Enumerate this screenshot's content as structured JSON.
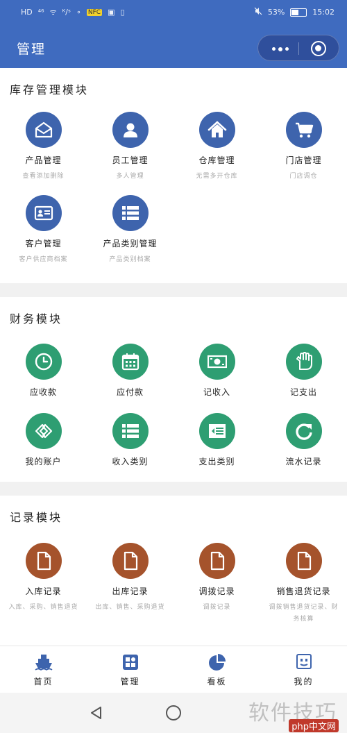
{
  "statusbar": {
    "left_items": [
      "HD",
      "⁴⁶",
      "ᯤ",
      "ᴷ/ˢ",
      "∘",
      "NFC",
      "▣",
      "▯"
    ],
    "battery_pct": "53%",
    "battery_level": 0.53,
    "time": "15:02"
  },
  "navbar": {
    "title": "管理"
  },
  "sections": {
    "inventory": {
      "title": "库存管理模块",
      "items": [
        {
          "label": "产品管理",
          "sub": "查看添加删除",
          "icon": "envelope-icon"
        },
        {
          "label": "员工管理",
          "sub": "多人管理",
          "icon": "user-icon"
        },
        {
          "label": "仓库管理",
          "sub": "无需多开仓库",
          "icon": "house-icon"
        },
        {
          "label": "门店管理",
          "sub": "门店调仓",
          "icon": "cart-icon"
        },
        {
          "label": "客户管理",
          "sub": "客户供应商档案",
          "icon": "id-card-icon"
        },
        {
          "label": "产品类别管理",
          "sub": "产品类别档案",
          "icon": "list-icon"
        }
      ]
    },
    "finance": {
      "title": "财务模块",
      "items": [
        {
          "label": "应收款",
          "icon": "clock-icon"
        },
        {
          "label": "应付款",
          "icon": "calendar-icon"
        },
        {
          "label": "记收入",
          "icon": "money-icon"
        },
        {
          "label": "记支出",
          "icon": "hand-icon"
        },
        {
          "label": "我的账户",
          "icon": "link-icon"
        },
        {
          "label": "收入类别",
          "icon": "list-icon"
        },
        {
          "label": "支出类别",
          "icon": "outdent-icon"
        },
        {
          "label": "流水记录",
          "icon": "refresh-icon"
        }
      ]
    },
    "records": {
      "title": "记录模块",
      "items": [
        {
          "label": "入库记录",
          "sub": "入库、采购、销售退货",
          "icon": "document-icon"
        },
        {
          "label": "出库记录",
          "sub": "出库、销售、采购退货",
          "icon": "document-icon"
        },
        {
          "label": "调拨记录",
          "sub": "调拨记录",
          "icon": "document-icon"
        },
        {
          "label": "销售退货记录",
          "sub": "调拨销售退货记录、财务核算",
          "icon": "document-icon"
        }
      ]
    }
  },
  "tabbar": [
    {
      "label": "首页",
      "icon": "ship-icon"
    },
    {
      "label": "管理",
      "icon": "grid-icon"
    },
    {
      "label": "看板",
      "icon": "pie-chart-icon"
    },
    {
      "label": "我的",
      "icon": "face-icon"
    }
  ],
  "watermark": {
    "text": "软件技巧",
    "badge": "php中文网"
  },
  "colors": {
    "primary": "#3f6bbf",
    "blue_icon": "#3e64ad",
    "green_icon": "#2e9e72",
    "brown_icon": "#a5532c"
  }
}
